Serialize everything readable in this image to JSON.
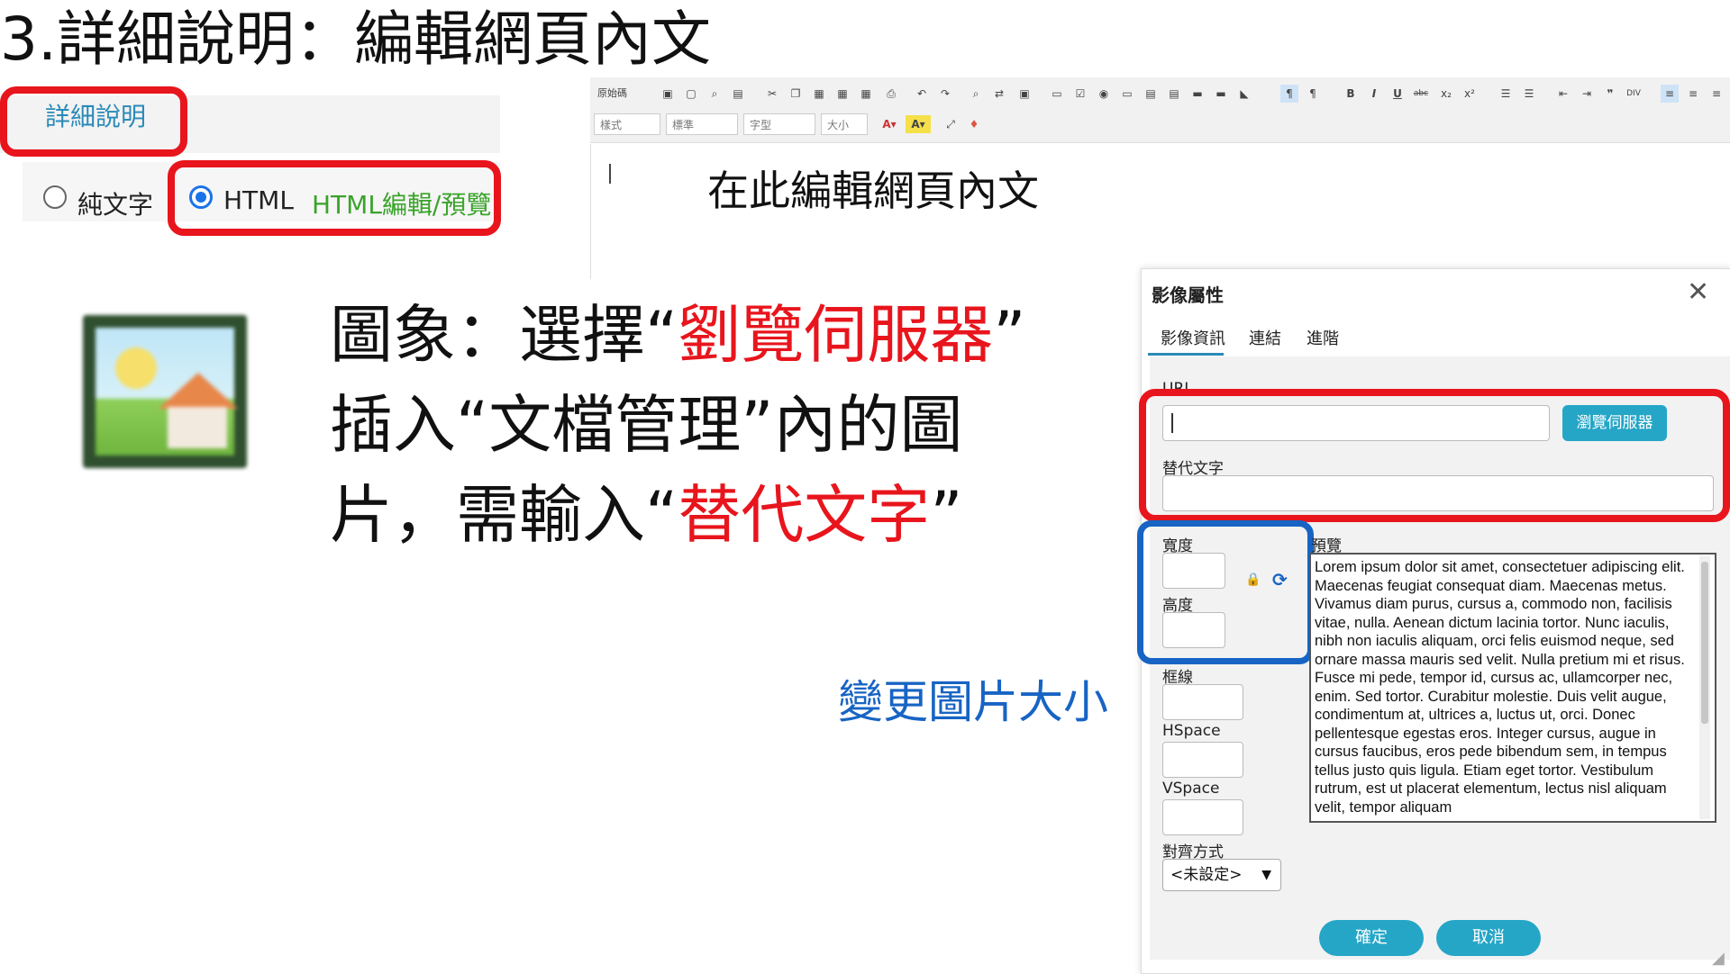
{
  "slide": {
    "title": "3.詳細說明：編輯網頁內文"
  },
  "form": {
    "tab_label": "詳細說明",
    "option_plain": "純文字",
    "option_html": "HTML",
    "html_edit_link": "HTML編輯/預覽",
    "selected": "HTML"
  },
  "editor": {
    "hint": "在此編輯網頁內文",
    "toolbar_row1": [
      "原始碼",
      "儲存",
      "新增",
      "預覽",
      "範本",
      "剪下",
      "複製",
      "貼上",
      "貼為純文字",
      "從Word貼上",
      "列印",
      "復原",
      "重做",
      "尋找",
      "取代",
      "全選",
      "表單",
      "核取方塊",
      "選項按鈕",
      "文字方塊",
      "文字區域",
      "選單",
      "按鈕",
      "影像按鈕",
      "隱藏欄位",
      "由左至右",
      "由右至左",
      "粗體",
      "斜體",
      "底線",
      "刪除線",
      "下標",
      "上標",
      "編號清單",
      "項目清單",
      "減少縮排",
      "增加縮排",
      "引用",
      "DIV",
      "靠左對齊",
      "置中",
      "靠右對齊"
    ],
    "dropdowns": [
      "樣式",
      "標準",
      "字型",
      "大小"
    ],
    "toolbar_row2_icons": [
      "text-color-icon",
      "bg-color-icon",
      "maximize-icon",
      "show-blocks-icon"
    ]
  },
  "instruction": {
    "line1_prefix": "圖象：選擇“",
    "line1_highlight": "劉覽伺服器",
    "line1_suffix": "”",
    "line2": "插入“文檔管理”內的圖",
    "line3_prefix": "片，需輸入“",
    "line3_highlight": "替代文字",
    "line3_suffix": "”",
    "resize_note": "變更圖片大小"
  },
  "dialog": {
    "title": "影像屬性",
    "tabs": [
      "影像資訊",
      "連結",
      "進階"
    ],
    "url_label": "URL",
    "browse_button": "瀏覽伺服器",
    "alt_label": "替代文字",
    "width_label": "寬度",
    "height_label": "高度",
    "border_label": "框線",
    "hspace_label": "HSpace",
    "vspace_label": "VSpace",
    "align_label": "對齊方式",
    "align_value": "<未設定>",
    "preview_label": "預覽",
    "preview_text": "Lorem ipsum dolor sit amet, consectetuer adipiscing elit. Maecenas feugiat consequat diam. Maecenas metus. Vivamus diam purus, cursus a, commodo non, facilisis vitae, nulla. Aenean dictum lacinia tortor. Nunc iaculis, nibh non iaculis aliquam, orci felis euismod neque, sed ornare massa mauris sed velit. Nulla pretium mi et risus. Fusce mi pede, tempor id, cursus ac, ullamcorper nec, enim. Sed tortor. Curabitur molestie. Duis velit augue, condimentum at, ultrices a, luctus ut, orci. Donec pellentesque egestas eros. Integer cursus, augue in cursus faucibus, eros pede bibendum sem, in tempus tellus justo quis ligula. Etiam eget tortor. Vestibulum rutrum, est ut placerat elementum, lectus nisl aliquam velit, tempor aliquam",
    "ok_button": "確定",
    "cancel_button": "取消"
  },
  "colors": {
    "highlight_red": "#e8151d",
    "highlight_blue": "#1764c4",
    "accent_teal": "#25a6c7",
    "link_green": "#3aa32b"
  }
}
